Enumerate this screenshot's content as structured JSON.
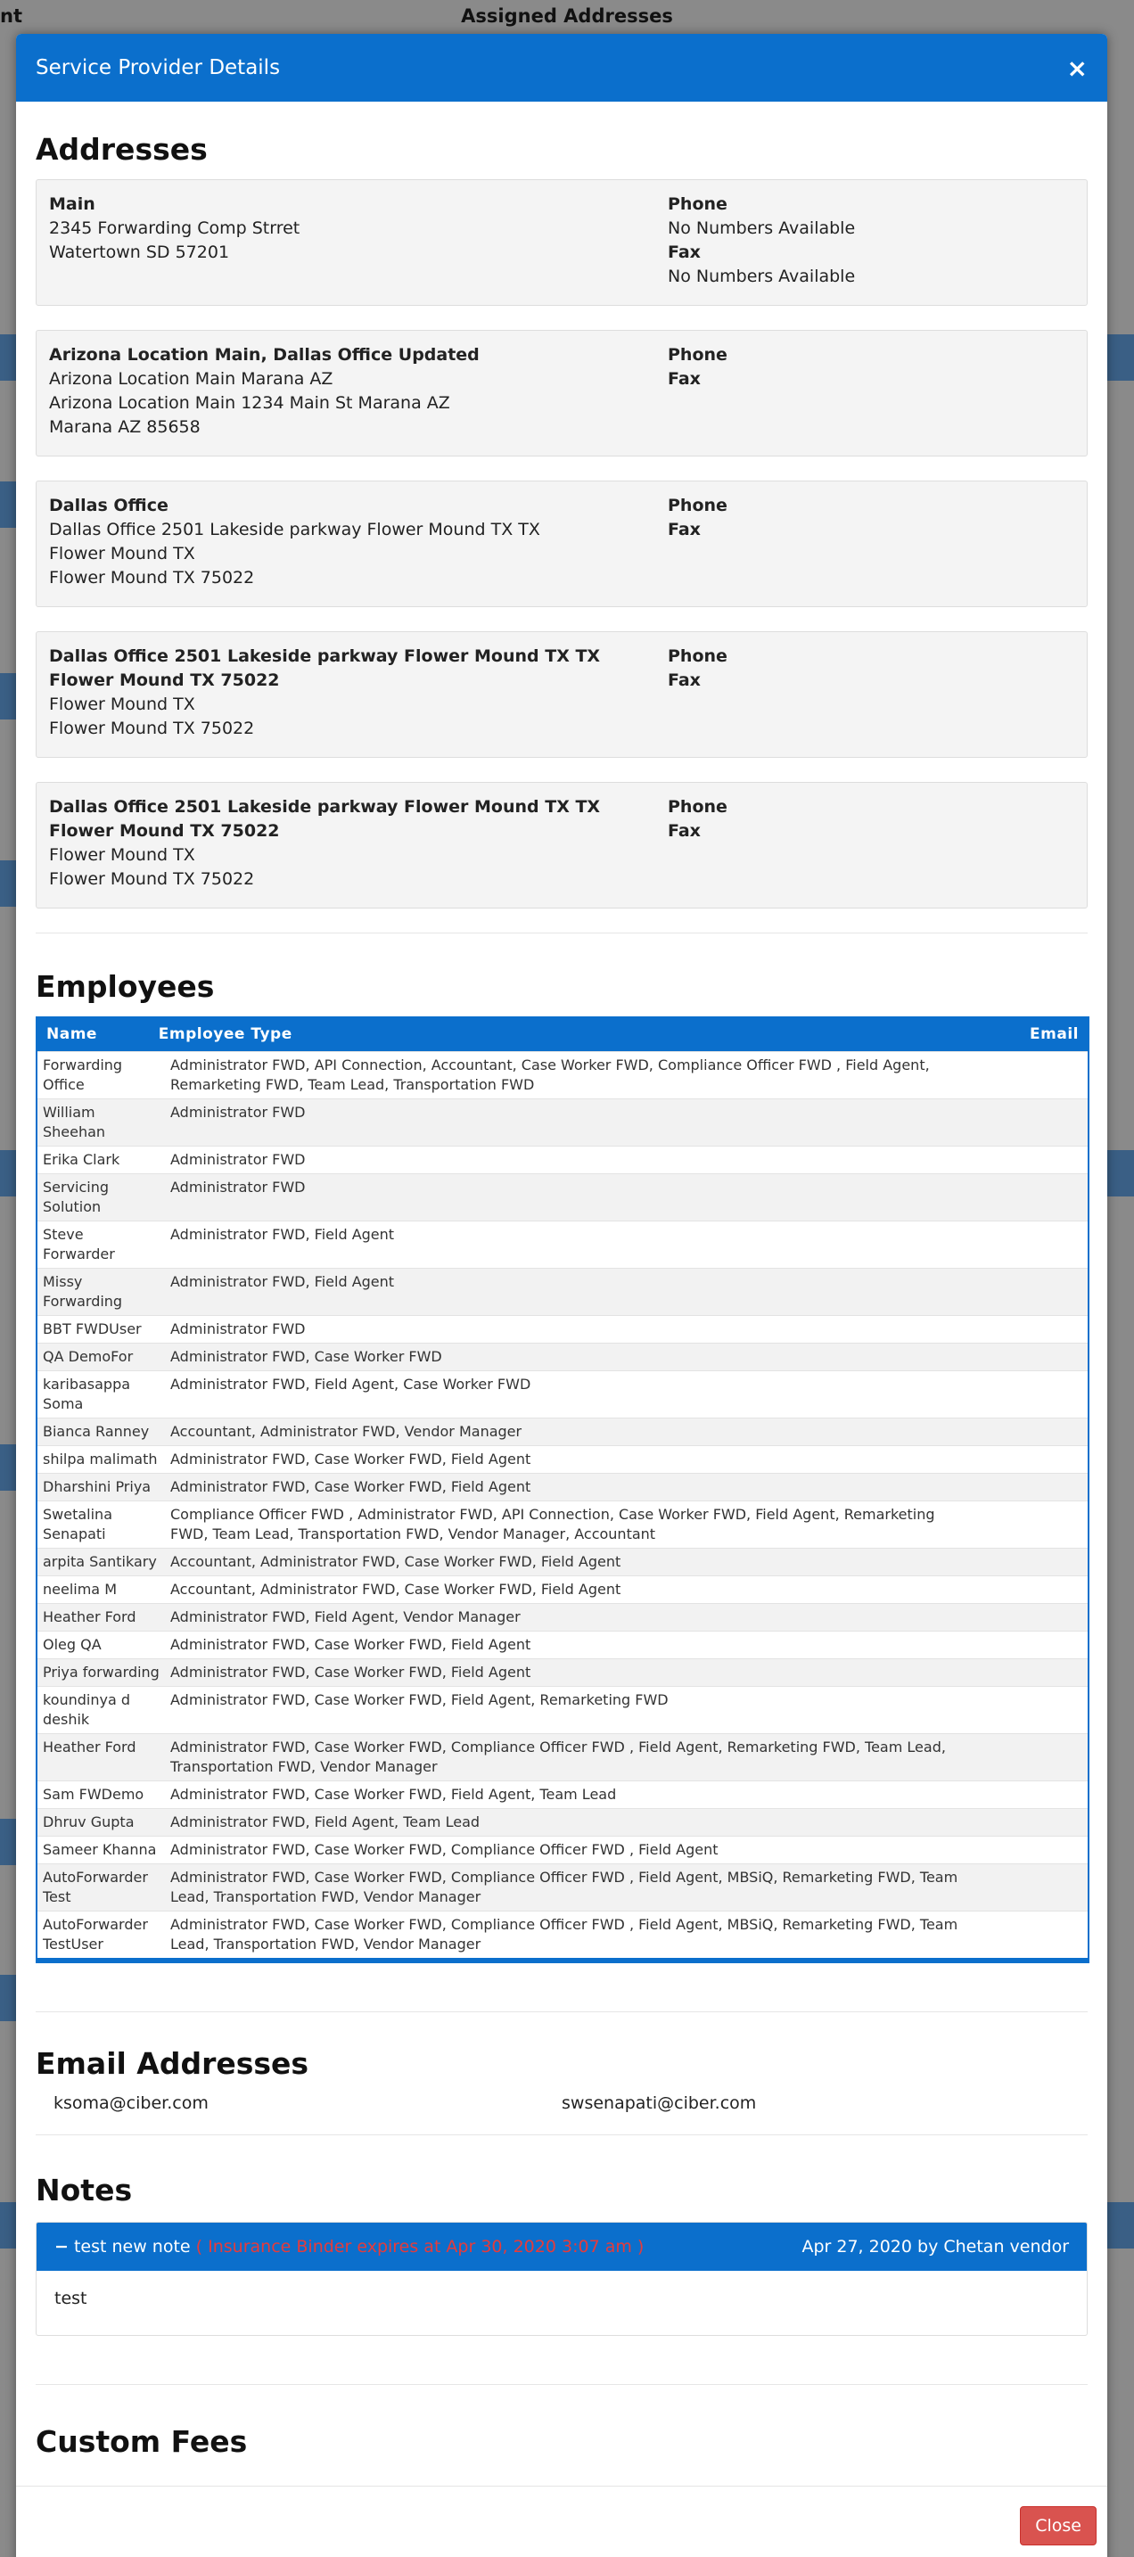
{
  "background": {
    "title": "Assigned Addresses",
    "left_title": "nt"
  },
  "modal": {
    "title": "Service Provider Details",
    "close_icon": "×"
  },
  "addresses": {
    "heading": "Addresses",
    "phone_label": "Phone",
    "fax_label": "Fax",
    "items": [
      {
        "name": "Main",
        "lines": [
          "2345 Forwarding Comp Strret",
          "Watertown SD 57201",
          ""
        ],
        "phone": "No Numbers Available",
        "fax": "No Numbers Available"
      },
      {
        "name": "Arizona Location Main, Dallas Office Updated",
        "lines": [
          "Arizona Location Main Marana AZ",
          "Arizona Location Main 1234 Main St Marana AZ",
          "Marana AZ 85658"
        ],
        "phone": "",
        "fax": ""
      },
      {
        "name": "Dallas Office",
        "lines": [
          "Dallas Office 2501 Lakeside parkway Flower Mound TX TX",
          "Flower Mound TX",
          "Flower Mound TX 75022"
        ],
        "phone": "",
        "fax": ""
      },
      {
        "name": "Dallas Office 2501 Lakeside parkway Flower Mound TX TX Flower Mound TX 75022",
        "lines": [
          "Flower Mound TX",
          "Flower Mound TX 75022",
          ""
        ],
        "phone": "",
        "fax": ""
      },
      {
        "name": "Dallas Office 2501 Lakeside parkway Flower Mound TX TX Flower Mound TX 75022",
        "lines": [
          "Flower Mound TX",
          "Flower Mound TX 75022",
          ""
        ],
        "phone": "",
        "fax": ""
      }
    ]
  },
  "employees": {
    "heading": "Employees",
    "columns": [
      "Name",
      "Employee Type",
      "Email"
    ],
    "rows": [
      [
        "Forwarding Office",
        "Administrator FWD, API Connection, Accountant, Case Worker FWD, Compliance Officer FWD , Field Agent, Remarketing FWD, Team Lead, Transportation FWD"
      ],
      [
        "William Sheehan",
        "Administrator FWD"
      ],
      [
        "Erika Clark",
        "Administrator FWD"
      ],
      [
        "Servicing Solution",
        "Administrator FWD"
      ],
      [
        "Steve Forwarder",
        "Administrator FWD, Field Agent"
      ],
      [
        "Missy Forwarding",
        "Administrator FWD, Field Agent"
      ],
      [
        "BBT FWDUser",
        "Administrator FWD"
      ],
      [
        "QA DemoFor",
        "Administrator FWD, Case Worker FWD"
      ],
      [
        "karibasappa Soma",
        "Administrator FWD, Field Agent, Case Worker FWD"
      ],
      [
        "Bianca Ranney",
        "Accountant, Administrator FWD, Vendor Manager"
      ],
      [
        "shilpa malimath",
        "Administrator FWD, Case Worker FWD, Field Agent"
      ],
      [
        "Dharshini Priya",
        "Administrator FWD, Case Worker FWD, Field Agent"
      ],
      [
        "Swetalina Senapati",
        "Compliance Officer FWD , Administrator FWD, API Connection, Case Worker FWD, Field Agent, Remarketing FWD, Team Lead, Transportation FWD, Vendor Manager, Accountant"
      ],
      [
        "arpita Santikary",
        "Accountant, Administrator FWD, Case Worker FWD, Field Agent"
      ],
      [
        "neelima M",
        "Accountant, Administrator FWD, Case Worker FWD, Field Agent"
      ],
      [
        "Heather Ford",
        "Administrator FWD, Field Agent, Vendor Manager"
      ],
      [
        "Oleg QA",
        "Administrator FWD, Case Worker FWD, Field Agent"
      ],
      [
        "Priya forwarding",
        "Administrator FWD, Case Worker FWD, Field Agent"
      ],
      [
        "koundinya d deshik",
        "Administrator FWD, Case Worker FWD, Field Agent, Remarketing FWD"
      ],
      [
        "Heather Ford",
        "Administrator FWD, Case Worker FWD, Compliance Officer FWD , Field Agent, Remarketing FWD, Team Lead, Transportation FWD, Vendor Manager"
      ],
      [
        "Sam FWDemo",
        "Administrator FWD, Case Worker FWD, Field Agent, Team Lead"
      ],
      [
        "Dhruv Gupta",
        "Administrator FWD, Field Agent, Team Lead"
      ],
      [
        "Sameer Khanna",
        "Administrator FWD, Case Worker FWD, Compliance Officer FWD , Field Agent"
      ],
      [
        "AutoForwarder Test",
        "Administrator FWD, Case Worker FWD, Compliance Officer FWD , Field Agent, MBSiQ, Remarketing FWD, Team Lead, Transportation FWD, Vendor Manager"
      ],
      [
        "AutoForwarder TestUser",
        "Administrator FWD, Case Worker FWD, Compliance Officer FWD , Field Agent, MBSiQ, Remarketing FWD, Team Lead, Transportation FWD, Vendor Manager"
      ]
    ]
  },
  "email_addresses": {
    "heading": "Email Addresses",
    "items": [
      "ksoma@ciber.com",
      "swsenapati@ciber.com"
    ]
  },
  "notes": {
    "heading": "Notes",
    "items": [
      {
        "toggle": "−",
        "title": "test new note",
        "warning": "( Insurance Binder expires at Apr 30, 2020 3:07 am )",
        "meta": "Apr 27, 2020 by Chetan vendor",
        "body": "test"
      }
    ]
  },
  "custom_fees": {
    "heading": "Custom Fees"
  },
  "footer": {
    "close_label": "Close"
  },
  "colors": {
    "primary": "#0b6fcc",
    "danger": "#d9534f",
    "warning_text": "#e63b3b"
  }
}
